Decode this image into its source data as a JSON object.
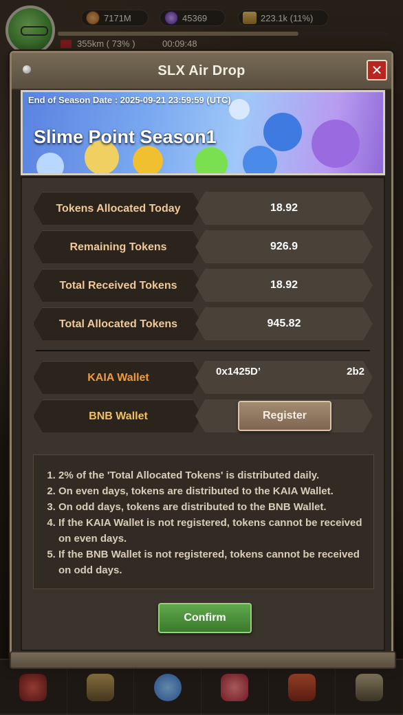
{
  "hud": {
    "gold": "7171M",
    "gems": "45369",
    "tokens": "223.1k (11%)",
    "distance": "355km ( 73% )",
    "timer": "00:09:48"
  },
  "dialog": {
    "title": "SLX Air Drop",
    "close_label": "✕",
    "banner": {
      "season_end": "End of Season Date : 2025-09-21 23:59:59 (UTC)",
      "season_title": "Slime Point Season1"
    },
    "stats": [
      {
        "label": "Tokens Allocated Today",
        "value": "18.92"
      },
      {
        "label": "Remaining Tokens",
        "value": "926.9"
      },
      {
        "label": "Total Received Tokens",
        "value": "18.92"
      },
      {
        "label": "Total Allocated Tokens",
        "value": "945.82"
      }
    ],
    "wallets": {
      "kaia_label": "KAIA Wallet",
      "kaia_address_start": "0x1425D’",
      "kaia_address_end": "2b2",
      "bnb_label": "BNB Wallet",
      "register_label": "Register"
    },
    "notes": [
      "2% of the 'Total Allocated Tokens' is distributed daily.",
      "On even days, tokens are distributed to the KAIA Wallet.",
      "On odd days, tokens are distributed to the BNB Wallet.",
      "If the KAIA Wallet is not registered, tokens cannot be received on even days.",
      "If the BNB Wallet is not registered, tokens cannot be received on odd days."
    ],
    "confirm_label": "Confirm"
  },
  "icons": {
    "gold": "coin-icon",
    "gems": "gem-icon",
    "tokens": "token-icon",
    "close": "close-icon"
  },
  "colors": {
    "close_button": "#b8261f",
    "confirm_button": "#4a8f3a",
    "label_text": "#f0c89a",
    "kaia_label_text": "#f09a3a"
  }
}
